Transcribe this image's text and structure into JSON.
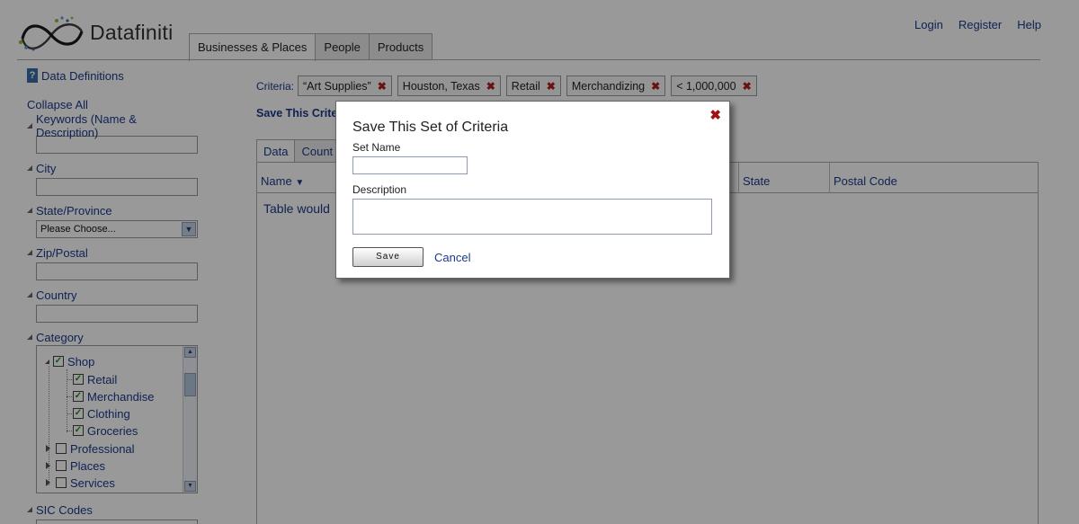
{
  "app": {
    "brand": "Datafiniti",
    "colors": {
      "link": "#1a3a8a",
      "close_red": "#b01e1e",
      "check_green": "#1b8a1b",
      "overlay": "rgba(0,0,0,0.4)"
    }
  },
  "header": {
    "links": {
      "login": "Login",
      "register": "Register",
      "help": "Help"
    },
    "tabs": [
      {
        "label": "Businesses & Places",
        "active": true
      },
      {
        "label": "People",
        "active": false
      },
      {
        "label": "Products",
        "active": false
      }
    ]
  },
  "sidebar": {
    "data_definitions": "Data Definitions",
    "collapse_all": "Collapse All",
    "filters": {
      "keywords": "Keywords (Name & Description)",
      "city": "City",
      "state": "State/Province",
      "state_select": "Please Choose...",
      "zip": "Zip/Postal",
      "country": "Country",
      "category": "Category",
      "sic": "SIC Codes"
    },
    "category_tree": {
      "shop": {
        "label": "Shop",
        "checked": true
      },
      "retail": {
        "label": "Retail",
        "checked": true
      },
      "merchandise": {
        "label": "Merchandise",
        "checked": true
      },
      "clothing": {
        "label": "Clothing",
        "checked": true
      },
      "groceries": {
        "label": "Groceries",
        "checked": true
      },
      "professional": {
        "label": "Professional",
        "checked": false
      },
      "places": {
        "label": "Places",
        "checked": false
      },
      "services": {
        "label": "Services",
        "checked": false
      }
    }
  },
  "main": {
    "criteria_label": "Criteria:",
    "chips": [
      "“Art Supplies”",
      "Houston, Texas",
      "Retail",
      "Merchandizing",
      "< 1,000,000"
    ],
    "chip_remove": "✖",
    "save_criteria": "Save This Crite",
    "data_tabs": {
      "data": "Data",
      "count": "Count"
    },
    "columns": {
      "name": "Name",
      "state": "State",
      "postal": "Postal Code"
    },
    "table_message": "Table would"
  },
  "modal": {
    "title": "Save This Set of Criteria",
    "close": "✖",
    "set_name_label": "Set Name",
    "set_name_value": "",
    "description_label": "Description",
    "description_value": "",
    "save": "Save",
    "cancel": "Cancel"
  }
}
